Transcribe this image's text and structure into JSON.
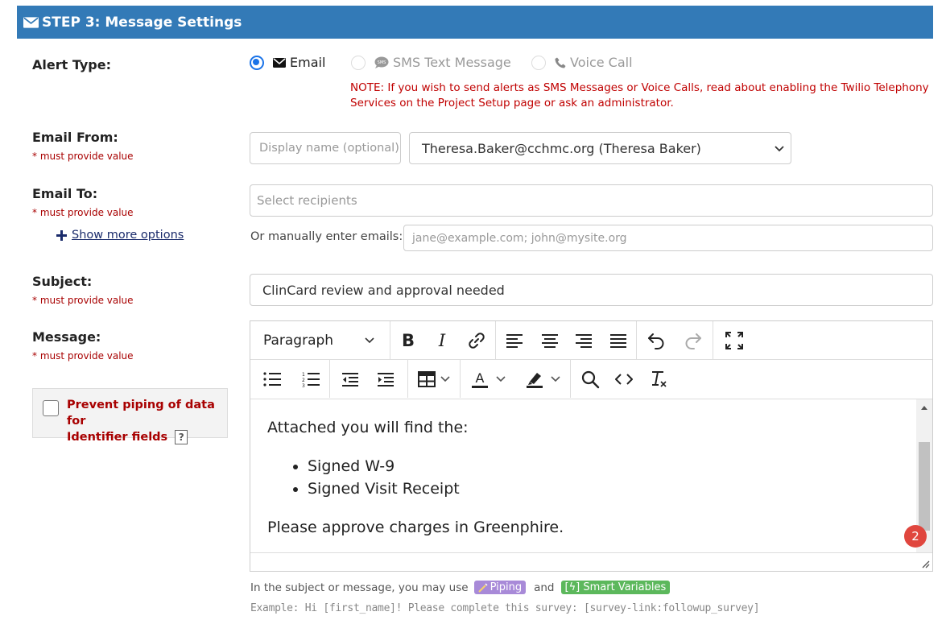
{
  "header": {
    "title": "STEP 3: Message Settings"
  },
  "alert_type": {
    "label": "Alert Type:",
    "options": [
      {
        "label": "Email",
        "selected": true
      },
      {
        "label": "SMS Text Message",
        "selected": false
      },
      {
        "label": "Voice Call",
        "selected": false
      }
    ],
    "note_line1": "NOTE: If you wish to send alerts as SMS Messages or Voice Calls, read about enabling the Twilio Telephony",
    "note_line2": "Services on the Project Setup page or ask an administrator."
  },
  "email_from": {
    "label": "Email From:",
    "required": "* must provide value",
    "display_name_placeholder": "Display name (optional)",
    "selected_sender": "Theresa.Baker@cchmc.org (Theresa Baker)"
  },
  "email_to": {
    "label": "Email To:",
    "required": "* must provide value",
    "recipients_placeholder": "Select recipients",
    "show_more": "Show more options",
    "manual_label": "Or manually enter emails:",
    "manual_placeholder": "jane@example.com; john@mysite.org"
  },
  "subject": {
    "label": "Subject:",
    "required": "* must provide value",
    "value": "ClinCard review and approval needed"
  },
  "message": {
    "label": "Message:",
    "required": "* must provide value",
    "block_format": "Paragraph",
    "body_intro": "Attached you will find the:",
    "bullets": [
      "Signed W-9",
      "Signed Visit Receipt"
    ],
    "body_outro": "Please approve charges in Greenphire.",
    "notification_count": "2"
  },
  "prevent_piping": {
    "line1": "Prevent piping of data for",
    "line2": "Identifier fields",
    "help": "?"
  },
  "help_text": {
    "prefix": "In the subject or message, you may use",
    "piping": "Piping",
    "and": "and",
    "smart_variables": "[ϟ] Smart Variables",
    "example": "Example: Hi [first_name]! Please complete this survey: [survey-link:followup_survey]"
  },
  "colors": {
    "header_bg": "#337ab7",
    "required_red": "#a80000",
    "note_red": "#c00000",
    "radio_blue": "#1a73e8",
    "piping_purple": "#a88ad8",
    "smart_green": "#5cb85c",
    "notification_red": "#e0463e"
  }
}
